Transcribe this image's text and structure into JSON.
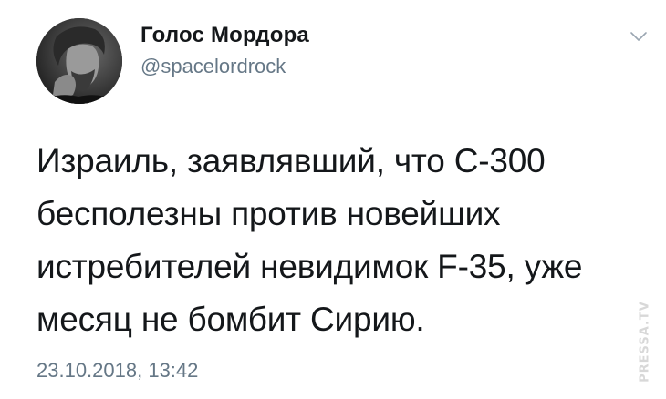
{
  "author": {
    "display_name": "Голос Мордора",
    "handle": "@spacelordrock"
  },
  "tweet": {
    "text": "Израиль, заявлявший, что С-300\nбесполезны против новейших\nистребителей невидимок F-35, уже\nмесяц не бомбит Сирию.",
    "timestamp": "23.10.2018, 13:42"
  },
  "icons": {
    "menu": "chevron-down-icon",
    "avatar": "avatar-photo"
  },
  "watermark": {
    "text": "PRESSA.TV"
  },
  "colors": {
    "text": "#14171a",
    "secondary": "#657786",
    "background": "#ffffff"
  }
}
